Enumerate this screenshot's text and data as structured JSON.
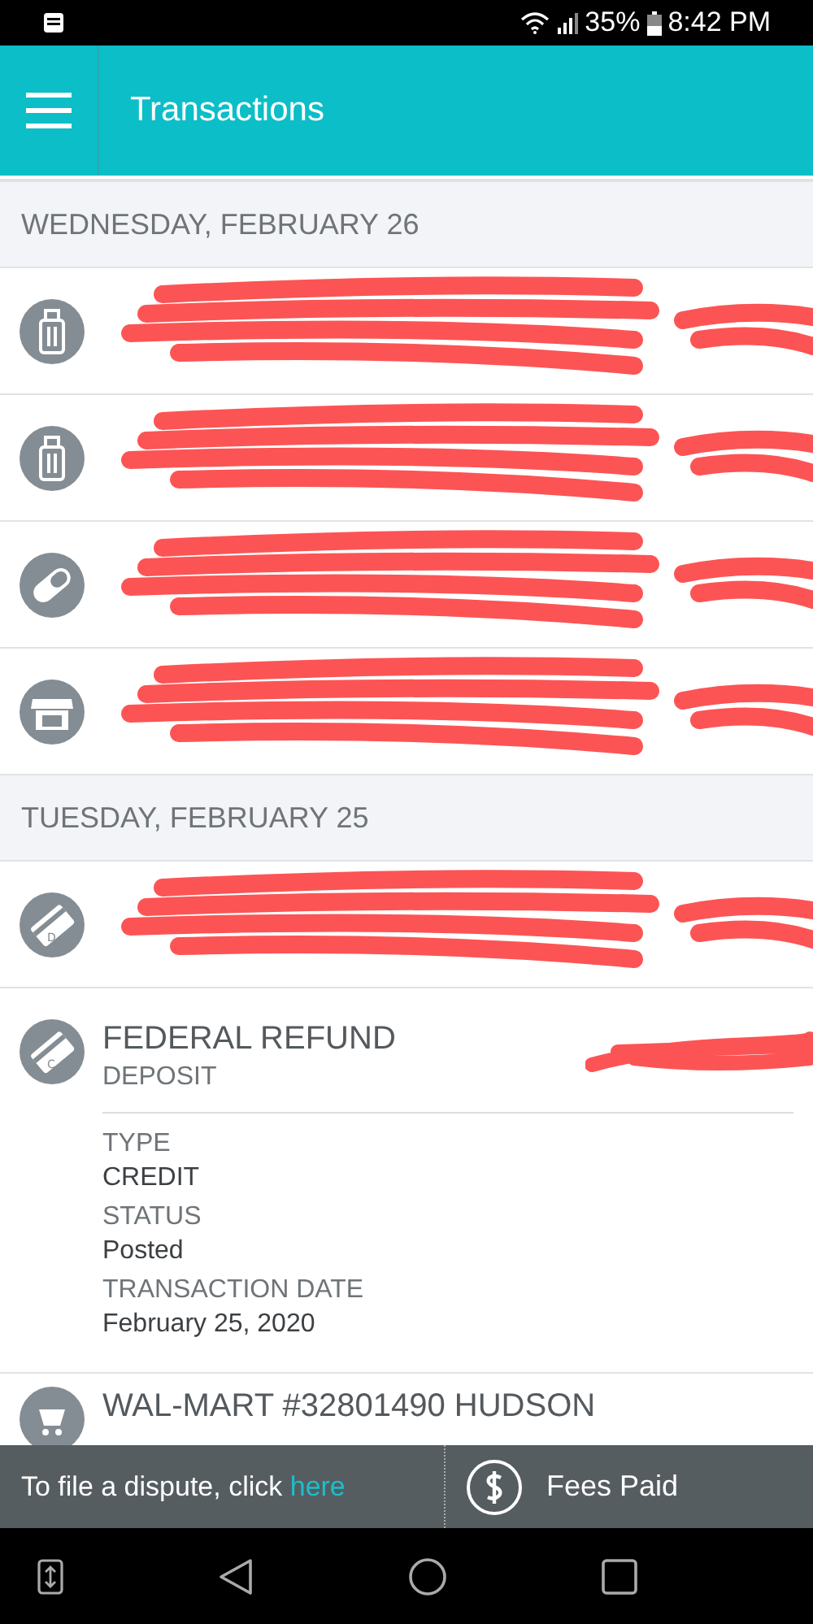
{
  "status_bar": {
    "battery": "35%",
    "time": "8:42 PM"
  },
  "app_bar": {
    "title": "Transactions"
  },
  "groups": [
    {
      "date": "WEDNESDAY, FEBRUARY 26",
      "rows": [
        {
          "kind": "luggage",
          "redacted": true
        },
        {
          "kind": "luggage",
          "redacted": true
        },
        {
          "kind": "pill",
          "redacted": true
        },
        {
          "kind": "store",
          "redacted": true
        }
      ]
    },
    {
      "date": "TUESDAY, FEBRUARY 25",
      "rows": [
        {
          "kind": "card",
          "badge": "D",
          "redacted": true
        },
        {
          "kind": "card",
          "badge": "C",
          "redacted": false,
          "title": "FEDERAL REFUND",
          "subtitle": "DEPOSIT",
          "amount_redacted": true,
          "expanded": true,
          "details": [
            {
              "label": "TYPE",
              "value": "CREDIT"
            },
            {
              "label": "STATUS",
              "value": "Posted"
            },
            {
              "label": "TRANSACTION DATE",
              "value": "February 25, 2020"
            }
          ]
        },
        {
          "kind": "cart",
          "redacted": false,
          "title": "WAL-MART #32801490 HUDSON"
        }
      ]
    }
  ],
  "footer": {
    "dispute_text": "To file a dispute, click",
    "dispute_link": "here",
    "fees": "Fees Paid"
  }
}
